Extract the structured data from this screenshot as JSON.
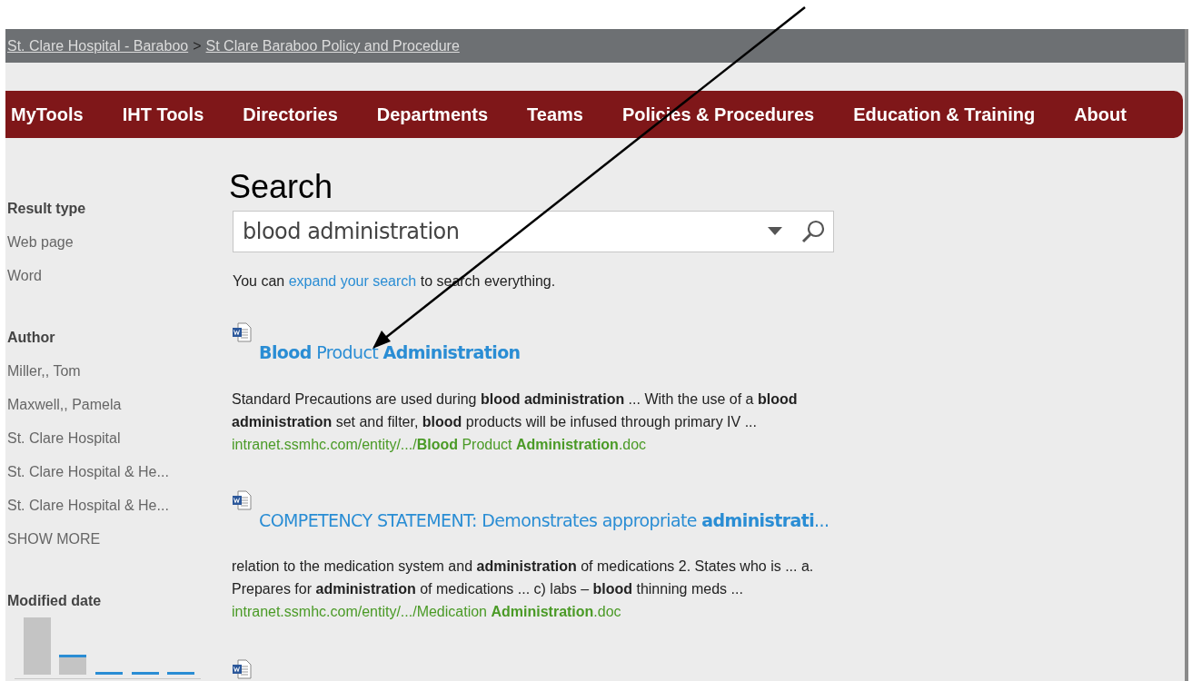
{
  "breadcrumb": [
    {
      "label": "St. Clare Hospital - Baraboo"
    },
    {
      "label": "St Clare Baraboo Policy and Procedure"
    }
  ],
  "breadcrumb_separator": ">",
  "nav": [
    "MyTools",
    "IHT Tools",
    "Directories",
    "Departments",
    "Teams",
    "Policies & Procedures",
    "Education & Training",
    "About"
  ],
  "refiners": [
    {
      "title": "Result type",
      "items": [
        "Web page",
        "Word"
      ]
    },
    {
      "title": "Author",
      "items": [
        "Miller,, Tom",
        "Maxwell,, Pamela",
        "St. Clare Hospital",
        "St. Clare Hospital & He...",
        "St. Clare Hospital & He..."
      ],
      "more": "SHOW MORE"
    },
    {
      "title": "Modified date",
      "kind": "histogram"
    }
  ],
  "search": {
    "title": "Search",
    "value": "blood administration"
  },
  "expand_note": {
    "before": "You can",
    "link": "expand your search",
    "after": "to search everything."
  },
  "results": [
    {
      "title": "**Blood** Product **Administration**",
      "snippet": "Standard Precautions are used during **blood administration** ... With the use of a **blood administration** set and filter, **blood** products will be infused through primary IV ...",
      "url": "intranet.ssmhc.com/entity/.../**Blood** Product **Administration**.doc"
    },
    {
      "title": "COMPETENCY STATEMENT: Demonstrates appropriate **administrati**...",
      "snippet": "relation to the medication system and **administration** of medications 2. States who is ... a. Prepares for **administration** of medications ... c) labs – **blood** thinning meds ...",
      "url": "intranet.ssmhc.com/entity/.../Medication **Administration**.doc"
    }
  ]
}
